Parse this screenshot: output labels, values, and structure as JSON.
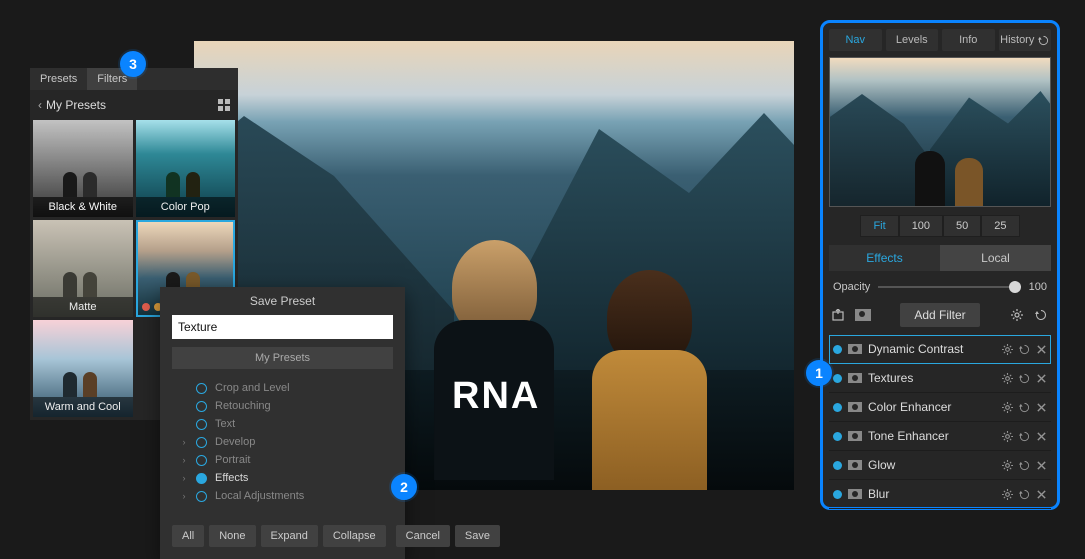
{
  "callouts": {
    "b1": "1",
    "b2": "2",
    "b3": "3"
  },
  "leftPanel": {
    "tabs": {
      "presets": "Presets",
      "filters": "Filters"
    },
    "backTitle": "My Presets",
    "items": [
      {
        "label": "Black & White"
      },
      {
        "label": "Color Pop"
      },
      {
        "label": "Matte"
      },
      {
        "label": ""
      },
      {
        "label": "Warm and Cool"
      }
    ]
  },
  "dialog": {
    "title": "Save Preset",
    "inputValue": "Texture",
    "categoryBtn": "My Presets",
    "options": [
      {
        "label": "Crop and Level",
        "expandable": false,
        "on": false
      },
      {
        "label": "Retouching",
        "expandable": false,
        "on": false
      },
      {
        "label": "Text",
        "expandable": false,
        "on": false
      },
      {
        "label": "Develop",
        "expandable": true,
        "on": false
      },
      {
        "label": "Portrait",
        "expandable": true,
        "on": false
      },
      {
        "label": "Effects",
        "expandable": true,
        "on": true
      },
      {
        "label": "Local Adjustments",
        "expandable": true,
        "on": false
      }
    ],
    "buttons": {
      "all": "All",
      "none": "None",
      "expand": "Expand",
      "collapse": "Collapse",
      "cancel": "Cancel",
      "save": "Save"
    }
  },
  "rightPanel": {
    "tabs": {
      "nav": "Nav",
      "levels": "Levels",
      "info": "Info",
      "history": "History"
    },
    "zoom": {
      "fit": "Fit",
      "z100": "100",
      "z50": "50",
      "z25": "25"
    },
    "elTabs": {
      "effects": "Effects",
      "local": "Local"
    },
    "opacity": {
      "label": "Opacity",
      "value": "100"
    },
    "addFilter": "Add Filter",
    "filters": [
      {
        "name": "Dynamic Contrast",
        "selected": true
      },
      {
        "name": "Textures"
      },
      {
        "name": "Color Enhancer"
      },
      {
        "name": "Tone Enhancer"
      },
      {
        "name": "Glow"
      },
      {
        "name": "Blur"
      }
    ]
  }
}
